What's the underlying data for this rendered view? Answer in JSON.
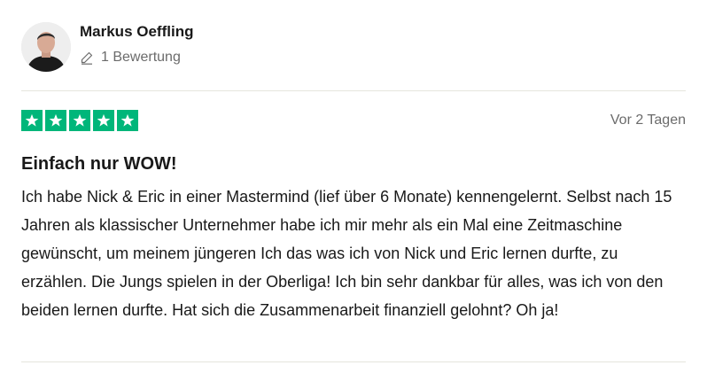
{
  "reviewer": {
    "name": "Markus Oeffling",
    "review_count": "1 Bewertung",
    "avatar_icon": "user-photo"
  },
  "review": {
    "rating": 5,
    "max_rating": 5,
    "date": "Vor 2 Tagen",
    "title": "Einfach nur WOW!",
    "text": "Ich habe Nick & Eric in einer Mastermind (lief über 6 Monate) kennengelernt. Selbst nach 15 Jahren als klassischer Unternehmer habe ich mir mehr als ein Mal eine Zeitmaschine gewünscht, um meinem jüngeren Ich das was ich von Nick und Eric lernen durfte, zu erzählen. Die Jungs spielen in der Oberliga! Ich bin sehr dankbar für alles, was ich von den beiden lernen durfte. Hat sich die Zusammenarbeit finanziell gelohnt? Oh ja!"
  },
  "colors": {
    "star_green": "#00b67a",
    "text_primary": "#191919",
    "text_secondary": "#6b6b6b",
    "divider": "#e5e5dd"
  },
  "icons": {
    "star": "star-icon",
    "pencil": "pencil-icon"
  }
}
